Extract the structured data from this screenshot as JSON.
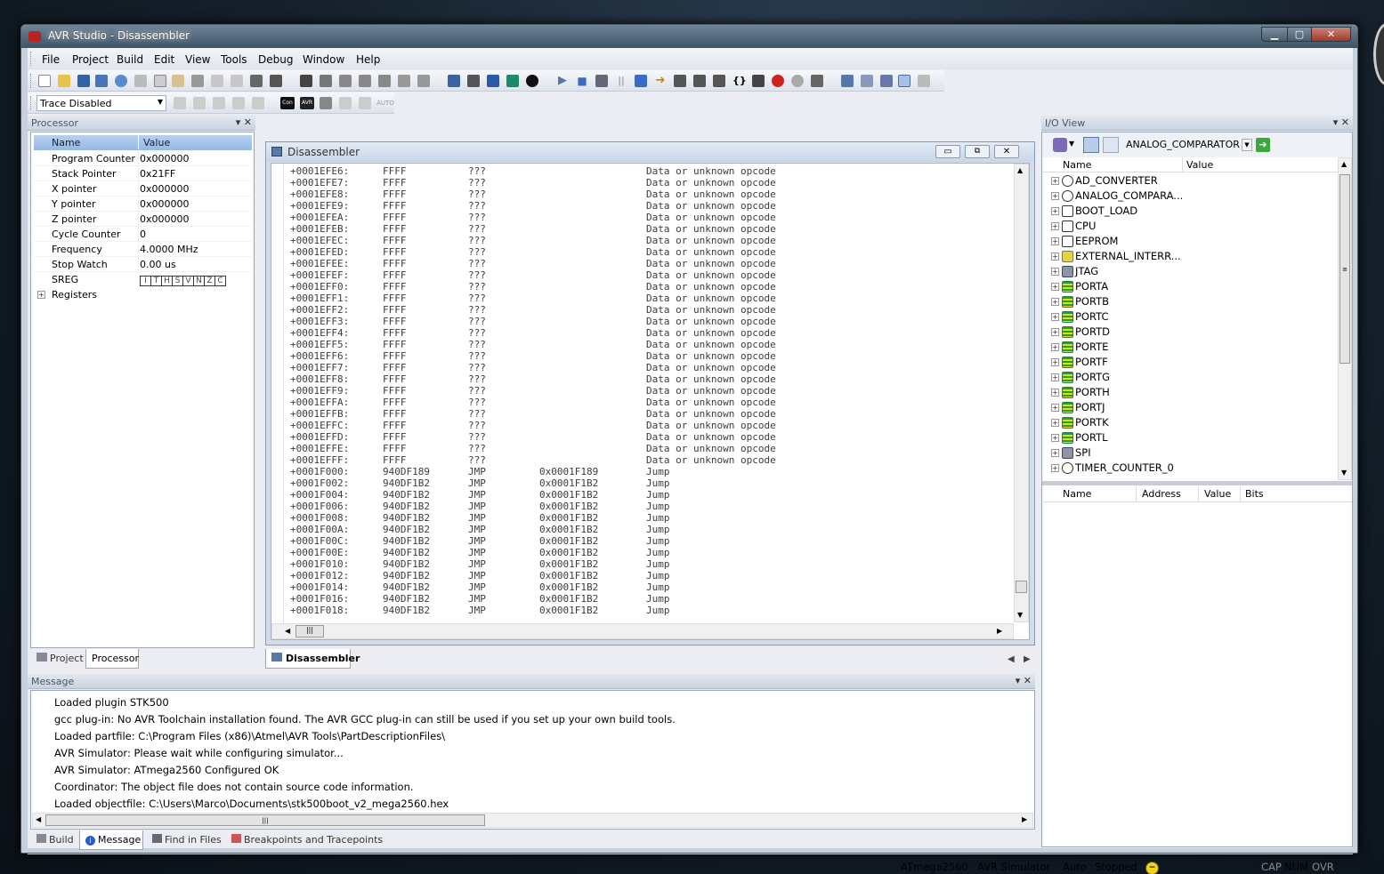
{
  "window": {
    "title": "AVR Studio - Disassembler"
  },
  "menu": [
    "File",
    "Project",
    "Build",
    "Edit",
    "View",
    "Tools",
    "Debug",
    "Window",
    "Help"
  ],
  "toolbar": {
    "trace_select": "Trace Disabled",
    "con_label": "Con",
    "avr_label": "AVR",
    "auto_label": "AUTO"
  },
  "processor": {
    "title": "Processor",
    "columns": [
      "Name",
      "Value"
    ],
    "rows": [
      {
        "name": "Program Counter",
        "value": "0x000000"
      },
      {
        "name": "Stack Pointer",
        "value": "0x21FF"
      },
      {
        "name": "X pointer",
        "value": "0x000000"
      },
      {
        "name": "Y pointer",
        "value": "0x000000"
      },
      {
        "name": "Z pointer",
        "value": "0x000000"
      },
      {
        "name": "Cycle Counter",
        "value": "0"
      },
      {
        "name": "Frequency",
        "value": "4.0000 MHz"
      },
      {
        "name": "Stop Watch",
        "value": "0.00 us"
      }
    ],
    "sreg_label": "SREG",
    "sreg_flags": [
      "I",
      "T",
      "H",
      "S",
      "V",
      "N",
      "Z",
      "C"
    ],
    "registers_label": "Registers",
    "tabs": [
      "Project",
      "Processor"
    ]
  },
  "disassembler": {
    "title": "Disassembler",
    "tab": "Disassembler",
    "lines": [
      {
        "addr": "+0001EFE6:",
        "op": "FFFF",
        "mn": "???",
        "arg": "",
        "cm": "Data or unknown opcode"
      },
      {
        "addr": "+0001EFE7:",
        "op": "FFFF",
        "mn": "???",
        "arg": "",
        "cm": "Data or unknown opcode"
      },
      {
        "addr": "+0001EFE8:",
        "op": "FFFF",
        "mn": "???",
        "arg": "",
        "cm": "Data or unknown opcode"
      },
      {
        "addr": "+0001EFE9:",
        "op": "FFFF",
        "mn": "???",
        "arg": "",
        "cm": "Data or unknown opcode"
      },
      {
        "addr": "+0001EFEA:",
        "op": "FFFF",
        "mn": "???",
        "arg": "",
        "cm": "Data or unknown opcode"
      },
      {
        "addr": "+0001EFEB:",
        "op": "FFFF",
        "mn": "???",
        "arg": "",
        "cm": "Data or unknown opcode"
      },
      {
        "addr": "+0001EFEC:",
        "op": "FFFF",
        "mn": "???",
        "arg": "",
        "cm": "Data or unknown opcode"
      },
      {
        "addr": "+0001EFED:",
        "op": "FFFF",
        "mn": "???",
        "arg": "",
        "cm": "Data or unknown opcode"
      },
      {
        "addr": "+0001EFEE:",
        "op": "FFFF",
        "mn": "???",
        "arg": "",
        "cm": "Data or unknown opcode"
      },
      {
        "addr": "+0001EFEF:",
        "op": "FFFF",
        "mn": "???",
        "arg": "",
        "cm": "Data or unknown opcode"
      },
      {
        "addr": "+0001EFF0:",
        "op": "FFFF",
        "mn": "???",
        "arg": "",
        "cm": "Data or unknown opcode"
      },
      {
        "addr": "+0001EFF1:",
        "op": "FFFF",
        "mn": "???",
        "arg": "",
        "cm": "Data or unknown opcode"
      },
      {
        "addr": "+0001EFF2:",
        "op": "FFFF",
        "mn": "???",
        "arg": "",
        "cm": "Data or unknown opcode"
      },
      {
        "addr": "+0001EFF3:",
        "op": "FFFF",
        "mn": "???",
        "arg": "",
        "cm": "Data or unknown opcode"
      },
      {
        "addr": "+0001EFF4:",
        "op": "FFFF",
        "mn": "???",
        "arg": "",
        "cm": "Data or unknown opcode"
      },
      {
        "addr": "+0001EFF5:",
        "op": "FFFF",
        "mn": "???",
        "arg": "",
        "cm": "Data or unknown opcode"
      },
      {
        "addr": "+0001EFF6:",
        "op": "FFFF",
        "mn": "???",
        "arg": "",
        "cm": "Data or unknown opcode"
      },
      {
        "addr": "+0001EFF7:",
        "op": "FFFF",
        "mn": "???",
        "arg": "",
        "cm": "Data or unknown opcode"
      },
      {
        "addr": "+0001EFF8:",
        "op": "FFFF",
        "mn": "???",
        "arg": "",
        "cm": "Data or unknown opcode"
      },
      {
        "addr": "+0001EFF9:",
        "op": "FFFF",
        "mn": "???",
        "arg": "",
        "cm": "Data or unknown opcode"
      },
      {
        "addr": "+0001EFFA:",
        "op": "FFFF",
        "mn": "???",
        "arg": "",
        "cm": "Data or unknown opcode"
      },
      {
        "addr": "+0001EFFB:",
        "op": "FFFF",
        "mn": "???",
        "arg": "",
        "cm": "Data or unknown opcode"
      },
      {
        "addr": "+0001EFFC:",
        "op": "FFFF",
        "mn": "???",
        "arg": "",
        "cm": "Data or unknown opcode"
      },
      {
        "addr": "+0001EFFD:",
        "op": "FFFF",
        "mn": "???",
        "arg": "",
        "cm": "Data or unknown opcode"
      },
      {
        "addr": "+0001EFFE:",
        "op": "FFFF",
        "mn": "???",
        "arg": "",
        "cm": "Data or unknown opcode"
      },
      {
        "addr": "+0001EFFF:",
        "op": "FFFF",
        "mn": "???",
        "arg": "",
        "cm": "Data or unknown opcode"
      },
      {
        "addr": "+0001F000:",
        "op": "940DF189",
        "mn": "JMP",
        "arg": "0x0001F189",
        "cm": "Jump"
      },
      {
        "addr": "+0001F002:",
        "op": "940DF1B2",
        "mn": "JMP",
        "arg": "0x0001F1B2",
        "cm": "Jump"
      },
      {
        "addr": "+0001F004:",
        "op": "940DF1B2",
        "mn": "JMP",
        "arg": "0x0001F1B2",
        "cm": "Jump"
      },
      {
        "addr": "+0001F006:",
        "op": "940DF1B2",
        "mn": "JMP",
        "arg": "0x0001F1B2",
        "cm": "Jump"
      },
      {
        "addr": "+0001F008:",
        "op": "940DF1B2",
        "mn": "JMP",
        "arg": "0x0001F1B2",
        "cm": "Jump"
      },
      {
        "addr": "+0001F00A:",
        "op": "940DF1B2",
        "mn": "JMP",
        "arg": "0x0001F1B2",
        "cm": "Jump"
      },
      {
        "addr": "+0001F00C:",
        "op": "940DF1B2",
        "mn": "JMP",
        "arg": "0x0001F1B2",
        "cm": "Jump"
      },
      {
        "addr": "+0001F00E:",
        "op": "940DF1B2",
        "mn": "JMP",
        "arg": "0x0001F1B2",
        "cm": "Jump"
      },
      {
        "addr": "+0001F010:",
        "op": "940DF1B2",
        "mn": "JMP",
        "arg": "0x0001F1B2",
        "cm": "Jump"
      },
      {
        "addr": "+0001F012:",
        "op": "940DF1B2",
        "mn": "JMP",
        "arg": "0x0001F1B2",
        "cm": "Jump"
      },
      {
        "addr": "+0001F014:",
        "op": "940DF1B2",
        "mn": "JMP",
        "arg": "0x0001F1B2",
        "cm": "Jump"
      },
      {
        "addr": "+0001F016:",
        "op": "940DF1B2",
        "mn": "JMP",
        "arg": "0x0001F1B2",
        "cm": "Jump"
      },
      {
        "addr": "+0001F018:",
        "op": "940DF1B2",
        "mn": "JMP",
        "arg": "0x0001F1B2",
        "cm": "Jump"
      }
    ]
  },
  "io_view": {
    "title": "I/O View",
    "selected": "ANALOG_COMPARATOR",
    "tree_columns": [
      "Name",
      "Value"
    ],
    "items": [
      {
        "label": "AD_CONVERTER",
        "icon": "ad-icon"
      },
      {
        "label": "ANALOG_COMPARA...",
        "icon": "ac-icon"
      },
      {
        "label": "BOOT_LOAD",
        "icon": "doc-icon"
      },
      {
        "label": "CPU",
        "icon": "doc-icon"
      },
      {
        "label": "EEPROM",
        "icon": "doc-icon"
      },
      {
        "label": "EXTERNAL_INTERR...",
        "icon": "ext-icon"
      },
      {
        "label": "JTAG",
        "icon": "jtag-icon"
      },
      {
        "label": "PORTA",
        "icon": "port-icon"
      },
      {
        "label": "PORTB",
        "icon": "port-icon"
      },
      {
        "label": "PORTC",
        "icon": "port-icon"
      },
      {
        "label": "PORTD",
        "icon": "port-icon"
      },
      {
        "label": "PORTE",
        "icon": "port-icon"
      },
      {
        "label": "PORTF",
        "icon": "port-icon"
      },
      {
        "label": "PORTG",
        "icon": "port-icon"
      },
      {
        "label": "PORTH",
        "icon": "port-icon"
      },
      {
        "label": "PORTJ",
        "icon": "port-icon"
      },
      {
        "label": "PORTK",
        "icon": "port-icon"
      },
      {
        "label": "PORTL",
        "icon": "port-icon"
      },
      {
        "label": "SPI",
        "icon": "jtag-icon"
      },
      {
        "label": "TIMER_COUNTER_0",
        "icon": "timer-icon"
      }
    ],
    "detail_columns": [
      "Name",
      "Address",
      "Value",
      "Bits"
    ]
  },
  "message": {
    "title": "Message",
    "lines": [
      "Loaded plugin STK500",
      "gcc plug-in: No AVR Toolchain installation found. The AVR GCC plug-in can still be used if you set up your own build tools.",
      "Loaded partfile: C:\\Program Files (x86)\\Atmel\\AVR Tools\\PartDescriptionFiles\\",
      "AVR Simulator: Please wait while configuring simulator...",
      "AVR Simulator: ATmega2560 Configured OK",
      "Coordinator: The object file does not contain source code information.",
      "Loaded objectfile: C:\\Users\\Marco\\Documents\\stk500boot_v2_mega2560.hex"
    ],
    "tabs": [
      "Build",
      "Message",
      "Find in Files",
      "Breakpoints and Tracepoints"
    ]
  },
  "statusbar": {
    "device": "ATmega2560",
    "platform": "AVR Simulator",
    "mode": "Auto",
    "state": "Stopped",
    "cap": "CAP",
    "num": "NUM",
    "ovr": "OVR"
  }
}
